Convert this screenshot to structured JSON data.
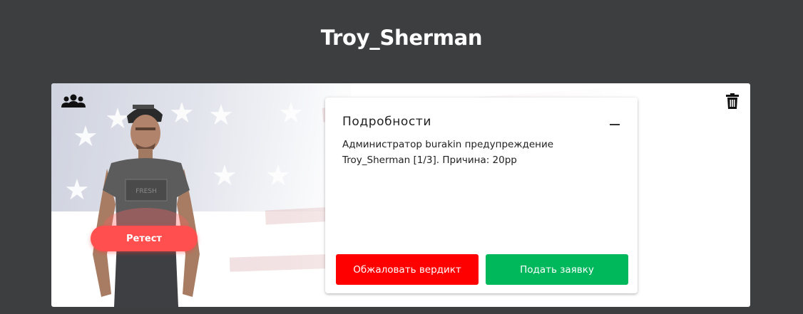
{
  "page": {
    "title": "Troy_Sherman"
  },
  "card": {
    "retest_label": "Ретест",
    "details": {
      "title": "Подробности",
      "text": "Администратор burakin предупреждение Troy_Sherman [1/3]. Причина: 20рр",
      "appeal_label": "Обжаловать вердикт",
      "apply_label": "Подать заявку"
    },
    "icons": {
      "team": "users-icon",
      "delete": "trash-icon",
      "collapse": "minus-icon"
    }
  },
  "colors": {
    "background": "#3d3e40",
    "retest": "#ff4f4f",
    "appeal": "#ff0000",
    "apply": "#00b85c"
  }
}
